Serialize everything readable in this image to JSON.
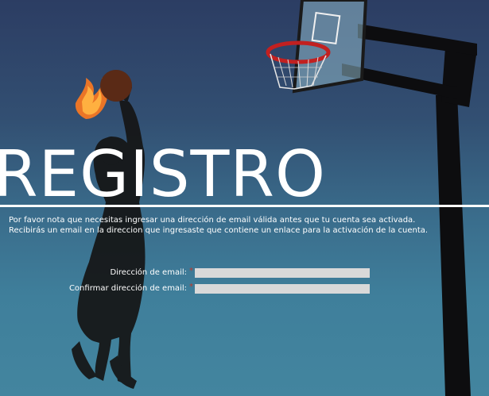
{
  "page": {
    "title": "REGISTRO",
    "notice_lines": [
      "Por favor nota que necesitas ingresar una dirección de email válida antes que tu cuenta sea activada.",
      "Recibirás un email en la direccion que ingresaste que contiene un enlace para la activación de la cuenta."
    ]
  },
  "form": {
    "email_label": "Dirección de email:",
    "email_required": "*",
    "email_value": "",
    "confirm_label": "Confirmar dirección de email:",
    "confirm_required": "*",
    "confirm_value": ""
  },
  "colors": {
    "background_top": "#2c3d63",
    "background_bottom": "#43859f",
    "required_marker": "#c0392b",
    "field_fill": "#d9d9d9"
  },
  "icons": {
    "ball": "basketball-icon",
    "hoop": "basketball-hoop-icon",
    "player": "player-silhouette-icon"
  }
}
